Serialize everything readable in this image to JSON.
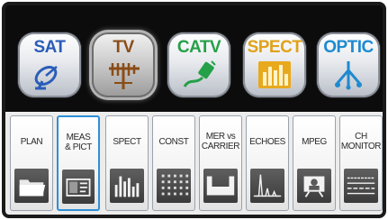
{
  "modes": [
    {
      "label": "SAT",
      "icon": "satellite-dish-icon",
      "color": "#2a5db8",
      "selected": false
    },
    {
      "label": "TV",
      "icon": "tv-antenna-icon",
      "color": "#9a5a1e",
      "selected": true
    },
    {
      "label": "CATV",
      "icon": "cable-plug-icon",
      "color": "#2aa84a",
      "selected": false
    },
    {
      "label": "SPECT",
      "icon": "spectrum-bars-icon",
      "color": "#e0a21a",
      "selected": false
    },
    {
      "label": "OPTIC",
      "icon": "fiber-splitter-icon",
      "color": "#1e8ad0",
      "selected": false
    }
  ],
  "tabs": [
    {
      "label": "PLAN",
      "icon": "folder-icon",
      "active": false
    },
    {
      "label": "MEAS\n& PICT",
      "icon": "measure-picture-icon",
      "active": true
    },
    {
      "label": "SPECT",
      "icon": "spectrum-icon",
      "active": false
    },
    {
      "label": "CONST",
      "icon": "constellation-icon",
      "active": false
    },
    {
      "label": "MER vs\nCARRIER",
      "icon": "mer-carrier-icon",
      "active": false
    },
    {
      "label": "ECHOES",
      "icon": "echoes-icon",
      "active": false
    },
    {
      "label": "MPEG",
      "icon": "mpeg-icon",
      "active": false
    },
    {
      "label": "CH\nMONITOR",
      "icon": "channel-monitor-icon",
      "active": false
    }
  ]
}
